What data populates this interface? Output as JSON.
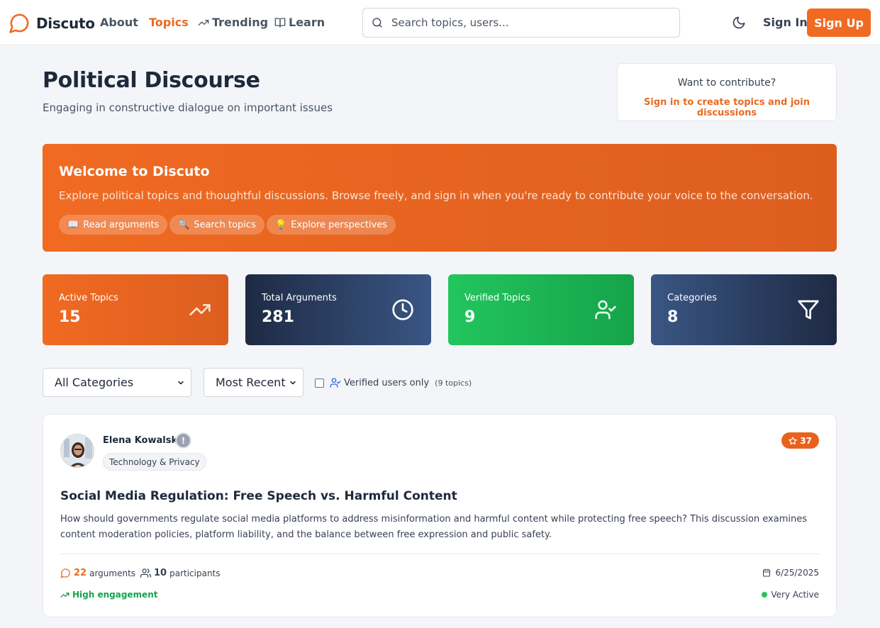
{
  "nav": {
    "brand": "Discuto",
    "links": [
      "About",
      "Topics",
      "Trending",
      "Learn"
    ],
    "active": "Topics",
    "search_placeholder": "Search topics, users...",
    "signin": "Sign In",
    "signup": "Sign Up",
    "icons": [
      "chat-bubble-logo",
      "trending-icon",
      "book-icon",
      "search-icon",
      "moon-icon"
    ]
  },
  "header": {
    "title": "Political Discourse",
    "subtitle": "Engaging in constructive dialogue on important issues",
    "contribute_question": "Want to contribute?",
    "contribute_link": "Sign in to create topics and join discussions"
  },
  "welcome": {
    "title": "Welcome to Discuto",
    "text": "Explore political topics and thoughtful discussions. Browse freely, and sign in when you're ready to contribute your voice to the conversation.",
    "chips": [
      {
        "emoji": "📖",
        "label": "Read arguments"
      },
      {
        "emoji": "🔍",
        "label": "Search topics"
      },
      {
        "emoji": "💡",
        "label": "Explore perspectives"
      }
    ]
  },
  "stats": [
    {
      "label": "Active Topics",
      "value": "15",
      "icon": "trending-up-icon",
      "color": "#f06a22"
    },
    {
      "label": "Total Arguments",
      "value": "281",
      "icon": "clock-icon",
      "color": "#1e2a44"
    },
    {
      "label": "Verified Topics",
      "value": "9",
      "icon": "user-check-icon",
      "color": "#22c55e"
    },
    {
      "label": "Categories",
      "value": "8",
      "icon": "filter-icon",
      "color": "#34527f"
    }
  ],
  "filters": {
    "category": "All Categories",
    "sort": "Most Recent",
    "verified_label": "Verified users only",
    "verified_count": "(9 topics)"
  },
  "topic": {
    "author": "Elena Kowalski",
    "unverified_mark": "!",
    "category": "Technology & Privacy",
    "stars": "37",
    "title": "Social Media Regulation: Free Speech vs. Harmful Content",
    "description": "How should governments regulate social media platforms to address misinformation and harmful content while protecting free speech? This discussion examines content moderation policies, platform liability, and the balance between free expression and public safety.",
    "arguments_count": "22",
    "arguments_label": "arguments",
    "participants_count": "10",
    "participants_label": "participants",
    "engagement": "High engagement",
    "date": "6/25/2025",
    "activity": "Very Active"
  }
}
